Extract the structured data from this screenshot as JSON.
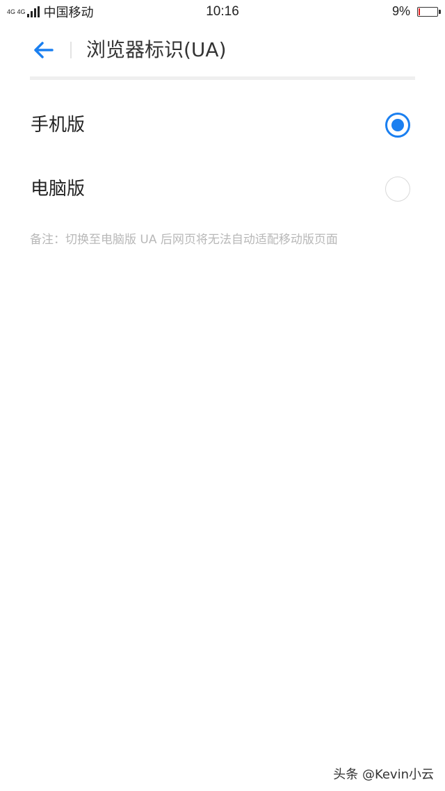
{
  "status_bar": {
    "network": "4G 4G",
    "carrier": "中国移动",
    "time": "10:16",
    "battery_percent": "9%",
    "battery_level": 0.09,
    "battery_color": "#e02020"
  },
  "header": {
    "back_icon": "arrow-left-icon",
    "title": "浏览器标识(UA)"
  },
  "options": [
    {
      "label": "手机版",
      "selected": true
    },
    {
      "label": "电脑版",
      "selected": false
    }
  ],
  "note": "备注：切换至电脑版 UA 后网页将无法自动适配移动版页面",
  "watermark": "头条 @Kevin小云",
  "colors": {
    "accent": "#1a7ff0",
    "note_text": "#b8b8b8"
  }
}
